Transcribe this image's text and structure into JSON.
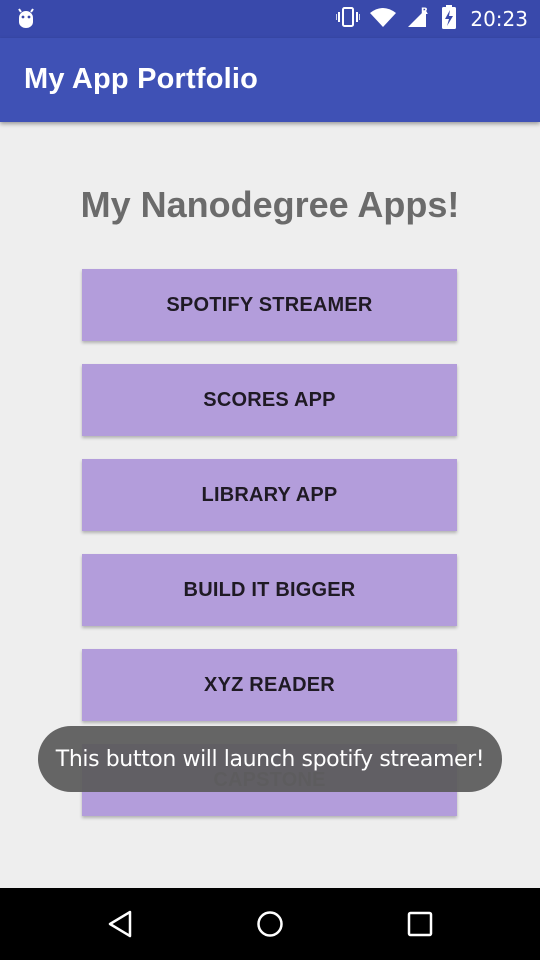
{
  "status_bar": {
    "time": "20:23",
    "icons": [
      "android-debug-icon",
      "vibrate-icon",
      "wifi-icon",
      "signal-icon",
      "battery-charging-icon"
    ]
  },
  "app_bar": {
    "title": "My App Portfolio",
    "color": "#3f51b5"
  },
  "main": {
    "heading": "My Nanodegree Apps!",
    "buttons": [
      {
        "label": "SPOTIFY STREAMER"
      },
      {
        "label": "SCORES APP"
      },
      {
        "label": "LIBRARY APP"
      },
      {
        "label": "BUILD IT BIGGER"
      },
      {
        "label": "XYZ READER"
      },
      {
        "label": "CAPSTONE"
      }
    ],
    "button_color": "#b39ddb"
  },
  "toast": {
    "text": "This button will launch spotify streamer!"
  },
  "nav_bar": {
    "icons": [
      "back-icon",
      "home-icon",
      "recents-icon"
    ]
  }
}
